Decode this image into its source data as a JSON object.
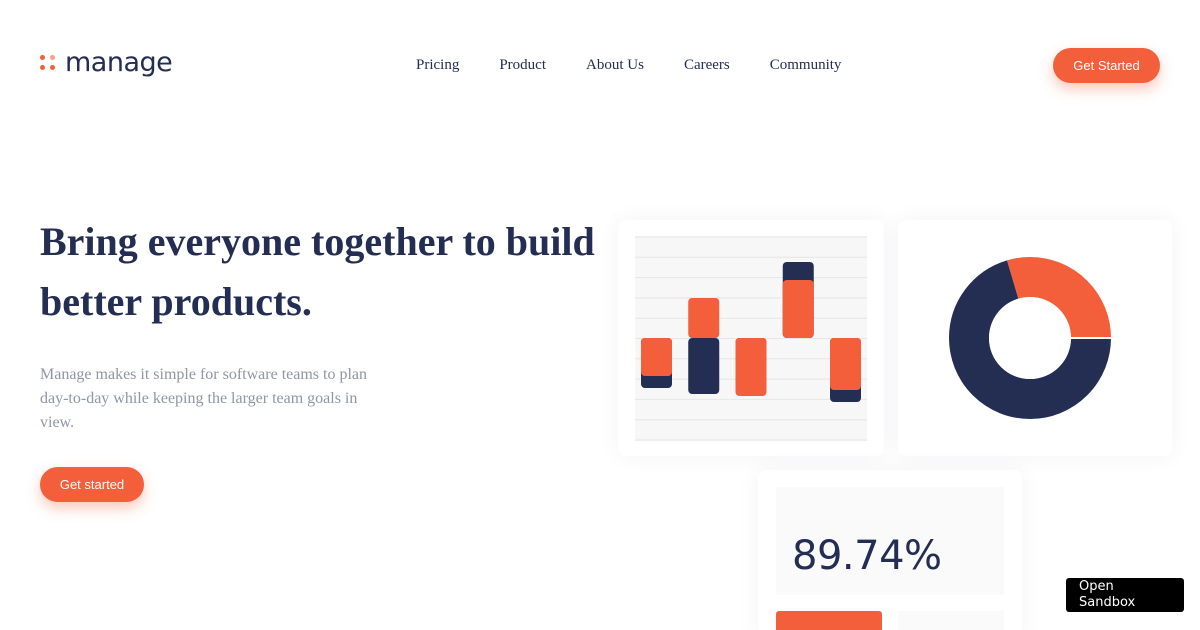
{
  "header": {
    "logo_text": "manage",
    "nav": [
      "Pricing",
      "Product",
      "About Us",
      "Careers",
      "Community"
    ],
    "cta_label": "Get Started"
  },
  "hero": {
    "title": "Bring everyone together to build better products.",
    "description": "Manage makes it simple for software teams to plan day-to-day while keeping the larger team goals in view.",
    "cta_label": "Get started"
  },
  "stats": {
    "value": "89.74%"
  },
  "sandbox": {
    "label": "Open Sandbox"
  },
  "colors": {
    "primary": "#f25f3a",
    "navy": "#242d52",
    "muted": "#9095a7"
  },
  "chart_data": [
    {
      "type": "bar",
      "series": [
        {
          "color": "#242d52",
          "values": [
            -2.5,
            -2.8,
            -1.9,
            3.8,
            -3.2
          ]
        },
        {
          "color": "#f25f3a",
          "values": [
            -1.9,
            2.0,
            -2.9,
            2.9,
            -2.6
          ]
        }
      ]
    },
    {
      "type": "pie",
      "values": [
        70.4,
        29.6
      ],
      "colors": [
        "#242d52",
        "#f25f3a"
      ]
    }
  ]
}
